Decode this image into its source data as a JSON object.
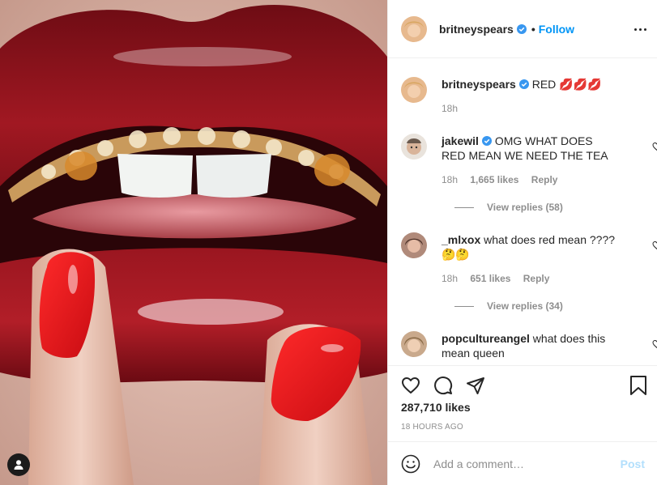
{
  "post": {
    "author": "britneyspears",
    "follow_label": "Follow",
    "dot": "•",
    "caption": {
      "username": "britneyspears",
      "text": "RED 💋💋💋",
      "time": "18h"
    }
  },
  "comments": [
    {
      "username": "jakewil",
      "verified": true,
      "text": "OMG WHAT DOES RED MEAN WE NEED THE TEA",
      "time": "18h",
      "likes": "1,665 likes",
      "reply": "Reply",
      "view_replies": "View replies (58)"
    },
    {
      "username": "_mlxox",
      "verified": false,
      "text": "what does red mean ???? 🤔🤔",
      "time": "18h",
      "likes": "651 likes",
      "reply": "Reply",
      "view_replies": "View replies (34)"
    },
    {
      "username": "popcultureangel",
      "verified": false,
      "text": "what does this mean queen"
    }
  ],
  "stats": {
    "likes": "287,710 likes",
    "time_ago": "18 HOURS AGO"
  },
  "composer": {
    "placeholder": "Add a comment…",
    "post_label": "Post"
  },
  "icons": {
    "verified": "verified-badge-icon",
    "like": "heart-icon",
    "comment": "speech-bubble-icon",
    "share": "paper-plane-icon",
    "save": "bookmark-icon",
    "more": "more-options-icon",
    "emoji": "smiley-icon",
    "tag": "user-tag-icon"
  },
  "colors": {
    "link_blue": "#0095f6",
    "verified_blue": "#3897f0",
    "post_disabled": "#b2dffc",
    "muted": "#8e8e8e"
  }
}
